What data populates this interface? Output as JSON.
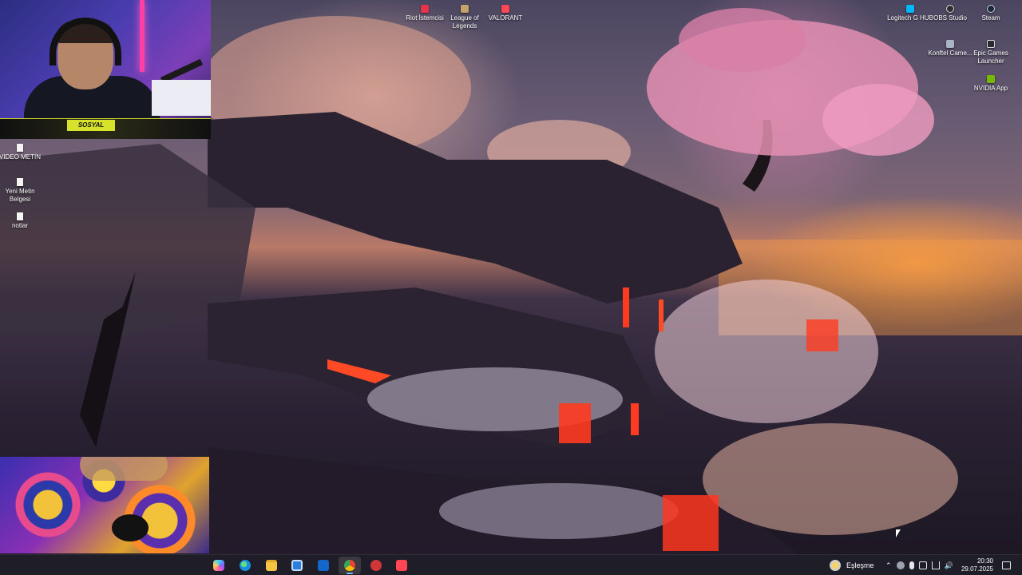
{
  "desktop": {
    "top_icons": [
      {
        "label": "Riot İstemcisi",
        "icon": "riot-client-icon"
      },
      {
        "label": "League of Legends",
        "icon": "league-of-legends-icon"
      },
      {
        "label": "VALORANT",
        "icon": "valorant-icon"
      }
    ],
    "right_icons": [
      {
        "label": "Logitech G HUB",
        "icon": "logitech-icon"
      },
      {
        "label": "OBS Studio",
        "icon": "obs-icon"
      },
      {
        "label": "Steam",
        "icon": "steam-icon"
      },
      {
        "label": "Konftel Came...",
        "icon": "konftel-icon"
      },
      {
        "label": "Epic Games Launcher",
        "icon": "epic-games-icon"
      },
      {
        "label": "NVIDIA App",
        "icon": "nvidia-icon"
      }
    ],
    "left_icons": [
      {
        "label": "VIDEO METİN",
        "icon": "text-file-icon"
      },
      {
        "label": "Yeni Metin Belgesi",
        "icon": "text-file-icon"
      },
      {
        "label": "notlar",
        "icon": "text-file-icon"
      }
    ]
  },
  "webcam": {
    "badge": "SOSYAL"
  },
  "taskbar": {
    "apps": [
      {
        "name": "Copilot",
        "icon": "copilot-icon"
      },
      {
        "name": "Microsoft Edge",
        "icon": "edge-icon"
      },
      {
        "name": "File Explorer",
        "icon": "file-explorer-icon"
      },
      {
        "name": "Microsoft Store",
        "icon": "store-icon"
      },
      {
        "name": "Outlook",
        "icon": "outlook-icon"
      },
      {
        "name": "Google Chrome",
        "icon": "chrome-icon",
        "active": true
      },
      {
        "name": "Riot Client",
        "icon": "riot-icon"
      },
      {
        "name": "VALORANT",
        "icon": "valorant-icon"
      }
    ],
    "weather_label": "Eşleşme",
    "clock_time": "20:30",
    "clock_date": "29.07.2025"
  }
}
